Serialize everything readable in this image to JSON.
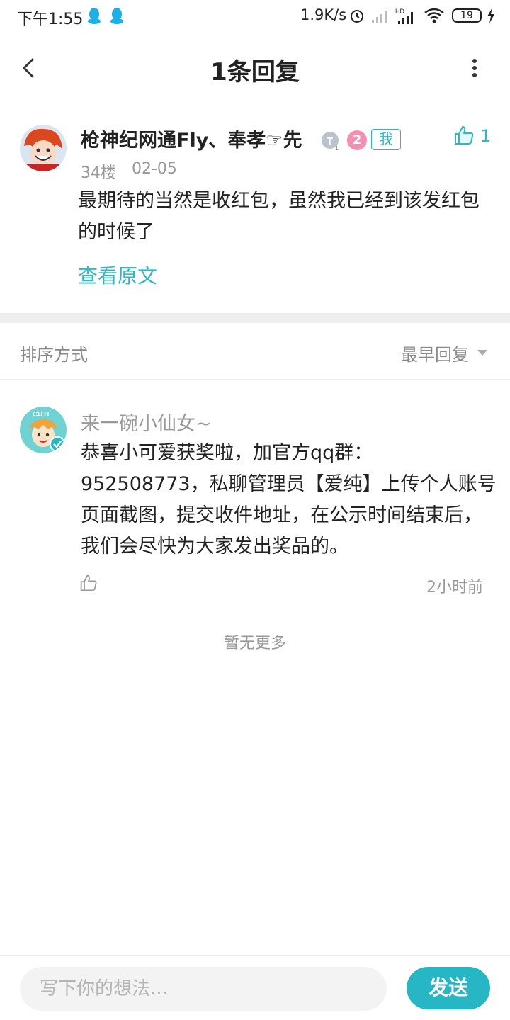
{
  "status_bar": {
    "time": "下午1:55",
    "speed": "1.9K/s",
    "battery": "19",
    "icons": [
      "qq-icon",
      "qq-icon",
      "alarm-icon",
      "signal-icon",
      "hd-signal-icon",
      "wifi-icon",
      "battery-icon",
      "charging-icon"
    ]
  },
  "header": {
    "title": "1条回复",
    "back_icon": "chevron-left-icon",
    "more_icon": "more-vertical-icon"
  },
  "post": {
    "username": "枪神纪网通Fly、奉孝☞先",
    "level": "2",
    "me_tag": "我",
    "likes": "1",
    "floor": "34楼",
    "date": "02-05",
    "body": "最期待的当然是收红包，虽然我已经到该发红包的时候了",
    "view_original": "查看原文"
  },
  "sort": {
    "label": "排序方式",
    "value": "最早回复"
  },
  "reply": {
    "username": "来一碗小仙女~",
    "body": "恭喜小可爱获奖啦，加官方qq群：952508773，私聊管理员【爱纯】上传个人账号页面截图，提交收件地址，在公示时间结束后，我们会尽快为大家发出奖品的。",
    "time": "2小时前"
  },
  "footer_note": "暂无更多",
  "bottom": {
    "input_placeholder": "写下你的想法...",
    "send_label": "发送"
  },
  "colors": {
    "accent": "#27b6c3",
    "text": "#222222",
    "muted": "#999999",
    "divider": "#eeeeee"
  }
}
